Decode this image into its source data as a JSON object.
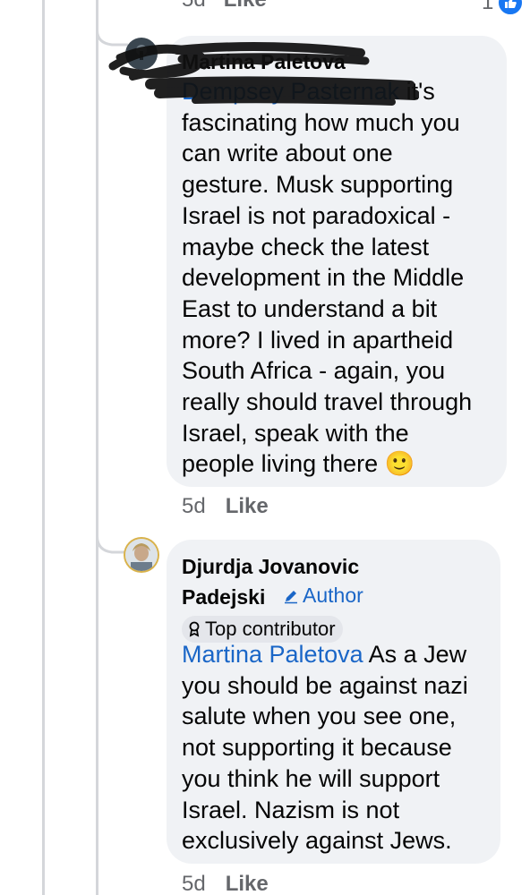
{
  "top_row": {
    "time": "5d",
    "like_label": "Like",
    "reaction_count": "1",
    "reaction_icon": "thumbs-up-icon"
  },
  "comments": [
    {
      "author": "Martina Paletova",
      "mention": "Dempsey Pasternak",
      "text": " it's\nfascinating how much you\ncan write about one\ngesture. Musk supporting\nIsrael is not paradoxical -\nmaybe check the latest\ndevelopment in the Middle\nEast to understand a bit\nmore? I lived in apartheid\nSouth Africa - again, you\nreally should travel through\nIsrael, speak with the\npeople living there",
      "emoji": "🙂",
      "time": "5d",
      "like_label": "Like",
      "redacted": true
    },
    {
      "author": "Djurdja Jovanovic\nPadejski",
      "author_badge": "Author",
      "badge_icon": "pencil-icon",
      "contributor_label": "Top contributor",
      "contributor_icon": "award-icon",
      "mention": "Martina Paletova",
      "text": " As a Jew\nyou should be against nazi\nsalute when you see one,\nnot supporting it because\nyou think he will support\nIsrael. Nazism is not\nexclusively against Jews.",
      "time": "5d",
      "like_label": "Like"
    }
  ],
  "colors": {
    "bubble": "#f0f2f5",
    "mention": "#1a66c7",
    "meta": "#65676b",
    "reaction": "#1877f2"
  }
}
